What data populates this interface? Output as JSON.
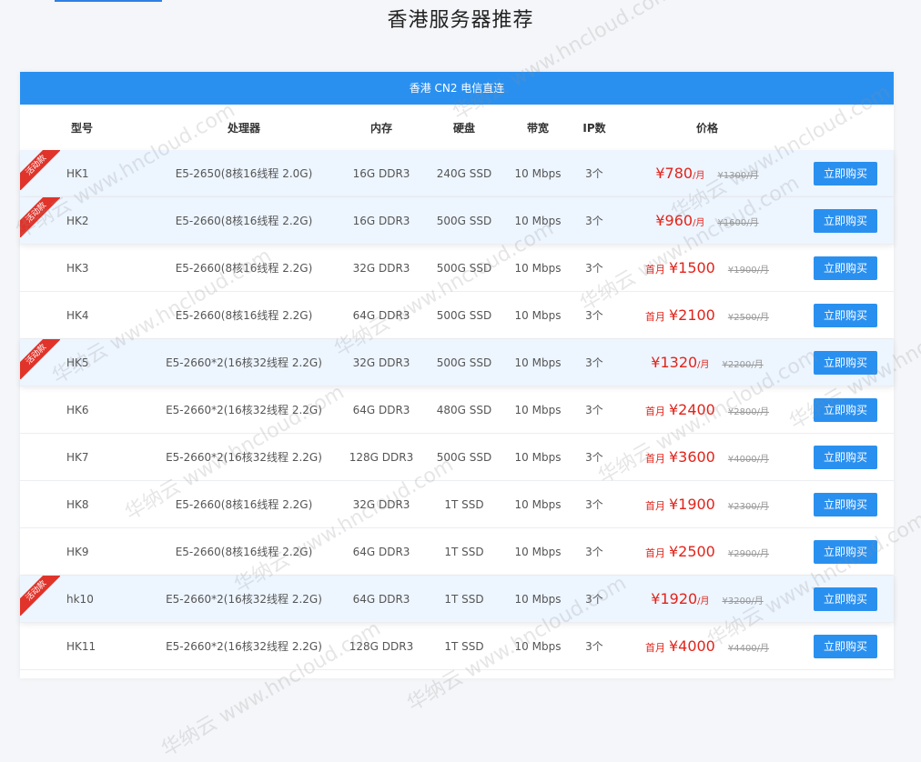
{
  "page": {
    "title": "香港服务器推荐"
  },
  "panel": {
    "header": "香港 CN2 电信直连"
  },
  "columns": {
    "model": "型号",
    "cpu": "处理器",
    "ram": "内存",
    "disk": "硬盘",
    "bandwidth": "带宽",
    "ip": "IP数",
    "price": "价格"
  },
  "promo_label": "活动款",
  "first_month_label": "首月",
  "currency": "¥",
  "per_month": "/月",
  "buy_label": "立即购买",
  "watermark_text": "华纳云 www.hncloud.com",
  "rows": [
    {
      "model": "HK1",
      "cpu": "E5-2650(8核16线程 2.0G)",
      "ram": "16G DDR3",
      "disk": "240G SSD",
      "bw": "10 Mbps",
      "ip": "3个",
      "price": "780",
      "old": "¥1300/月",
      "promo": true,
      "first": ""
    },
    {
      "model": "HK2",
      "cpu": "E5-2660(8核16线程 2.2G)",
      "ram": "16G DDR3",
      "disk": "500G SSD",
      "bw": "10 Mbps",
      "ip": "3个",
      "price": "960",
      "old": "¥1600/月",
      "promo": true,
      "first": ""
    },
    {
      "model": "HK3",
      "cpu": "E5-2660(8核16线程 2.2G)",
      "ram": "32G DDR3",
      "disk": "500G SSD",
      "bw": "10 Mbps",
      "ip": "3个",
      "price": "1500",
      "old": "¥1900/月",
      "promo": false,
      "first": "首月"
    },
    {
      "model": "HK4",
      "cpu": "E5-2660(8核16线程 2.2G)",
      "ram": "64G DDR3",
      "disk": "500G SSD",
      "bw": "10 Mbps",
      "ip": "3个",
      "price": "2100",
      "old": "¥2500/月",
      "promo": false,
      "first": "首月"
    },
    {
      "model": "HK5",
      "cpu": "E5-2660*2(16核32线程 2.2G)",
      "ram": "32G DDR3",
      "disk": "500G SSD",
      "bw": "10 Mbps",
      "ip": "3个",
      "price": "1320",
      "old": "¥2200/月",
      "promo": true,
      "first": ""
    },
    {
      "model": "HK6",
      "cpu": "E5-2660*2(16核32线程 2.2G)",
      "ram": "64G DDR3",
      "disk": "480G SSD",
      "bw": "10 Mbps",
      "ip": "3个",
      "price": "2400",
      "old": "¥2800/月",
      "promo": false,
      "first": "首月"
    },
    {
      "model": "HK7",
      "cpu": "E5-2660*2(16核32线程 2.2G)",
      "ram": "128G DDR3",
      "disk": "500G SSD",
      "bw": "10 Mbps",
      "ip": "3个",
      "price": "3600",
      "old": "¥4000/月",
      "promo": false,
      "first": "首月"
    },
    {
      "model": "HK8",
      "cpu": "E5-2660(8核16线程 2.2G)",
      "ram": "32G DDR3",
      "disk": "1T SSD",
      "bw": "10 Mbps",
      "ip": "3个",
      "price": "1900",
      "old": "¥2300/月",
      "promo": false,
      "first": "首月"
    },
    {
      "model": "HK9",
      "cpu": "E5-2660(8核16线程 2.2G)",
      "ram": "64G DDR3",
      "disk": "1T SSD",
      "bw": "10 Mbps",
      "ip": "3个",
      "price": "2500",
      "old": "¥2900/月",
      "promo": false,
      "first": "首月"
    },
    {
      "model": "hk10",
      "cpu": "E5-2660*2(16核32线程 2.2G)",
      "ram": "64G DDR3",
      "disk": "1T SSD",
      "bw": "10 Mbps",
      "ip": "3个",
      "price": "1920",
      "old": "¥3200/月",
      "promo": true,
      "first": ""
    },
    {
      "model": "HK11",
      "cpu": "E5-2660*2(16核32线程 2.2G)",
      "ram": "128G DDR3",
      "disk": "1T SSD",
      "bw": "10 Mbps",
      "ip": "3个",
      "price": "4000",
      "old": "¥4400/月",
      "promo": false,
      "first": "首月"
    }
  ]
}
